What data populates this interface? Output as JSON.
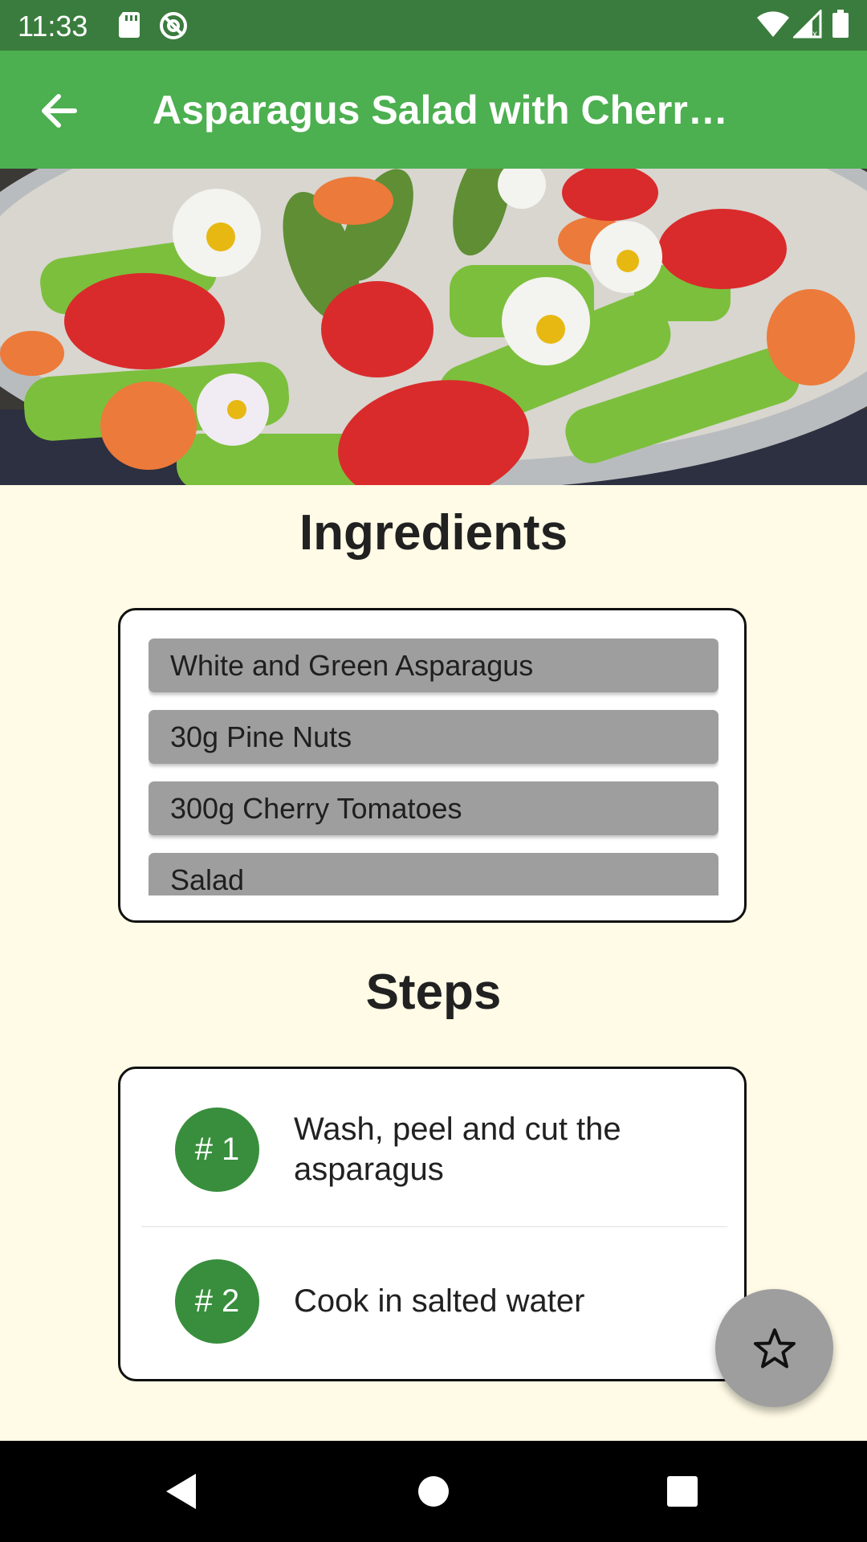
{
  "status_bar": {
    "time": "11:33",
    "left_icons": [
      "sd-card-icon",
      "at-sign-icon"
    ],
    "right_icons": [
      "wifi-icon",
      "cell-signal-icon",
      "battery-icon"
    ]
  },
  "app_bar": {
    "title": "Asparagus Salad with Cherry ...",
    "back_icon": "arrow-back-icon",
    "color": "#4caf50"
  },
  "hero": {
    "description_icon": "salad-photo"
  },
  "ingredients": {
    "heading": "Ingredients",
    "items": [
      "White and Green Asparagus",
      "30g Pine Nuts",
      "300g Cherry Tomatoes",
      "Salad"
    ]
  },
  "steps": {
    "heading": "Steps",
    "items": [
      {
        "number": "# 1",
        "text": "Wash, peel and cut the asparagus"
      },
      {
        "number": "# 2",
        "text": "Cook in salted water"
      }
    ],
    "badge_color": "#388e3c"
  },
  "fab": {
    "icon": "star-outline-icon"
  },
  "nav_bar": {
    "icons": [
      "back-triangle-icon",
      "home-circle-icon",
      "recents-square-icon"
    ]
  }
}
